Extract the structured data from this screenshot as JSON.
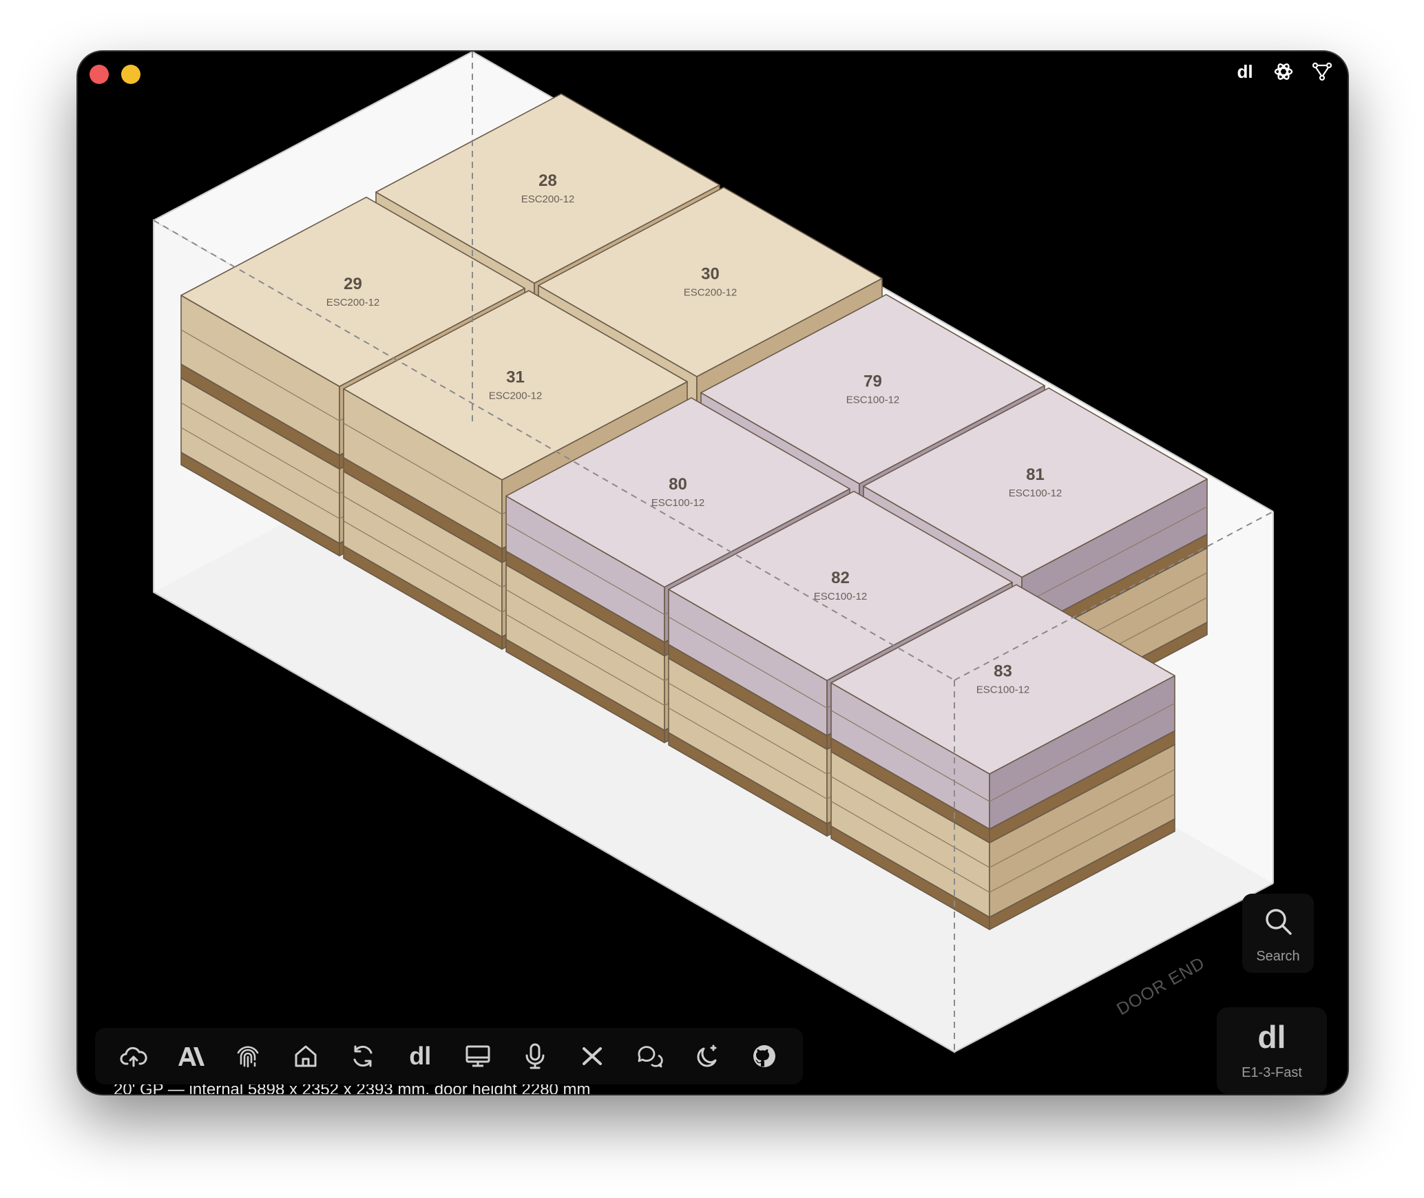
{
  "window": {
    "spec_text": "20' GP — internal 5898 x 2352 x 2393 mm, door height 2280 mm",
    "door_end_label": "DOOR END"
  },
  "top_icons": [
    "dl-logo-icon",
    "openai-icon",
    "network-icon"
  ],
  "dock_icons": [
    "cloud-upload-icon",
    "anthropic-icon",
    "fingerprint-icon",
    "home-icon",
    "refresh-icon",
    "dl-logo-icon",
    "monitor-icon",
    "microphone-icon",
    "x-icon",
    "chat-icon",
    "moon-sparkle-icon",
    "github-icon"
  ],
  "search": {
    "label": "Search"
  },
  "model": {
    "logo": "dl",
    "label": "E1-3-Fast"
  },
  "cargo": {
    "boxes": [
      {
        "id": "28",
        "sku": "ESC200-12"
      },
      {
        "id": "29",
        "sku": "ESC200-12"
      },
      {
        "id": "30",
        "sku": "ESC200-12"
      },
      {
        "id": "31",
        "sku": "ESC200-12"
      },
      {
        "id": "79",
        "sku": "ESC100-12"
      },
      {
        "id": "80",
        "sku": "ESC100-12"
      },
      {
        "id": "81",
        "sku": "ESC100-12"
      },
      {
        "id": "82",
        "sku": "ESC100-12"
      },
      {
        "id": "83",
        "sku": "ESC100-12"
      }
    ]
  },
  "colors": {
    "tan_top": "#e9dcc3",
    "tan_left": "#d4c2a0",
    "tan_right": "#c2ab86",
    "lilac_top": "#e2d8de",
    "lilac_left": "#c8bac4",
    "lilac_right": "#a898a6",
    "pallet_top": "#a5865c",
    "pallet_side": "#8a6a43",
    "container_back": "#f8f8f8",
    "container_floor": "#f1f1f1"
  }
}
